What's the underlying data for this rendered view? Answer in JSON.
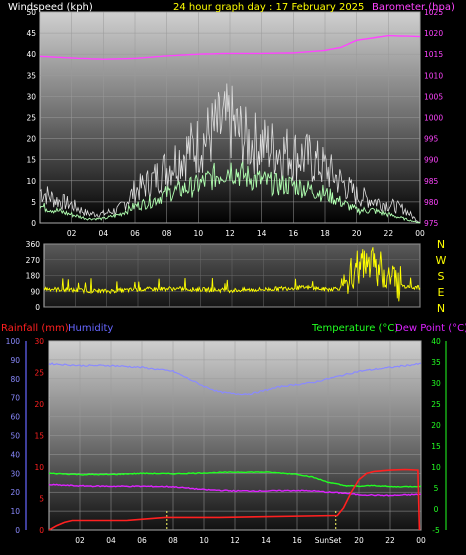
{
  "colors": {
    "white": "#ffffff",
    "yellow": "#ffff00",
    "magenta": "#ff44ff",
    "red": "#ff2020",
    "blue": "#6666ff",
    "green": "#22ff22",
    "purple": "#dd22ff",
    "lightgreen": "#b0ffb0",
    "gust": "#dddddd",
    "humidity": "#8a8aff",
    "sunset": "#ffff66"
  },
  "chart_data": [
    {
      "type": "line",
      "title": "24 hour graph day : 17 February 2025",
      "ylabel_left": "Windspeed (kph)",
      "ylabel_right": "Barometer (hpa)",
      "x_ticks": [
        "02",
        "04",
        "06",
        "08",
        "10",
        "12",
        "14",
        "16",
        "18",
        "20",
        "22",
        "00"
      ],
      "y_left_ticks": [
        "0",
        "5",
        "10",
        "15",
        "20",
        "25",
        "30",
        "35",
        "40",
        "45",
        "50"
      ],
      "y_right_ticks": [
        "975",
        "980",
        "985",
        "990",
        "995",
        "1000",
        "1005",
        "1010",
        "1015",
        "1020",
        "1025"
      ],
      "ylim_left": [
        0,
        50
      ],
      "ylim_right": [
        975,
        1025
      ],
      "series": [
        {
          "name": "Barometer (hpa)",
          "axis": "right",
          "x": [
            0,
            2,
            4,
            6,
            8,
            10,
            12,
            14,
            16,
            18,
            19,
            20,
            22,
            24
          ],
          "y": [
            1014.5,
            1014.1,
            1013.8,
            1014.0,
            1014.6,
            1015.0,
            1015.2,
            1015.2,
            1015.3,
            1015.9,
            1016.6,
            1018.3,
            1019.4,
            1019.2
          ]
        },
        {
          "name": "Gust",
          "axis": "left",
          "x": [
            0,
            1,
            2,
            3,
            4,
            5,
            6,
            7,
            8,
            9,
            10,
            11,
            12,
            13,
            14,
            15,
            16,
            17,
            18,
            19,
            20,
            21,
            22,
            23,
            24
          ],
          "y": [
            7,
            5,
            4,
            2,
            2,
            3,
            7,
            9,
            12,
            15,
            17,
            20,
            22,
            18,
            17,
            16,
            15,
            14,
            12,
            9,
            6,
            5,
            4,
            3,
            0
          ]
        },
        {
          "name": "Average",
          "axis": "left",
          "x": [
            0,
            1,
            2,
            3,
            4,
            5,
            6,
            7,
            8,
            9,
            10,
            11,
            12,
            13,
            14,
            15,
            16,
            17,
            18,
            19,
            20,
            21,
            22,
            23,
            24
          ],
          "y": [
            4,
            3,
            2,
            1,
            1,
            2,
            4,
            5,
            7,
            8,
            9,
            11,
            13,
            11,
            10,
            9,
            9,
            8,
            7,
            5,
            3,
            3,
            2,
            1,
            0
          ]
        }
      ]
    },
    {
      "type": "line",
      "title": "",
      "ylim": [
        0,
        360
      ],
      "y_ticks": [
        "0",
        "90",
        "180",
        "270",
        "360"
      ],
      "compass_labels": [
        "N",
        "W",
        "S",
        "E",
        "N"
      ],
      "series": [
        {
          "name": "Wind direction",
          "x": [
            0,
            2,
            4,
            6,
            8,
            10,
            12,
            14,
            16,
            17,
            18,
            19,
            20,
            21,
            22,
            23,
            24
          ],
          "y": [
            105,
            95,
            90,
            100,
            105,
            100,
            95,
            100,
            110,
            110,
            100,
            110,
            230,
            240,
            180,
            120,
            110
          ]
        }
      ]
    },
    {
      "type": "line",
      "ylabel_left_1": "Rainfall (mm)",
      "ylabel_left_2": "Humidity",
      "ylabel_right_1": "Temperature (°C)",
      "ylabel_right_2": "Dew Point (°C)",
      "x_ticks": [
        "02",
        "04",
        "06",
        "08",
        "10",
        "12",
        "14",
        "16",
        "SunSet",
        "20",
        "22",
        "00"
      ],
      "humidity_ticks": [
        "0",
        "10",
        "20",
        "30",
        "40",
        "50",
        "60",
        "70",
        "80",
        "90",
        "100"
      ],
      "rain_ticks": [
        "0",
        "5",
        "10",
        "15",
        "20",
        "25",
        "30"
      ],
      "temp_ticks": [
        "-5",
        "0",
        "5",
        "10",
        "15",
        "20",
        "25",
        "30",
        "35",
        "40"
      ],
      "ylim_rain": [
        0,
        30
      ],
      "ylim_humidity": [
        0,
        100
      ],
      "ylim_temp": [
        -5,
        40
      ],
      "series": [
        {
          "name": "Humidity",
          "axis": "humidity",
          "x": [
            0,
            2,
            4,
            6,
            8,
            10,
            11,
            12,
            13,
            14,
            15,
            16,
            17,
            18,
            20,
            22,
            24
          ],
          "y": [
            88,
            87,
            87,
            86,
            84,
            76,
            73,
            72,
            72,
            74,
            76,
            77,
            78,
            80,
            84,
            86,
            88
          ]
        },
        {
          "name": "Temperature (°C)",
          "axis": "temp",
          "x": [
            0,
            2,
            4,
            6,
            8,
            10,
            12,
            14,
            16,
            17,
            18,
            19,
            20,
            21,
            22,
            23,
            24
          ],
          "y": [
            8.5,
            8.2,
            8.2,
            8.5,
            8.4,
            8.6,
            8.8,
            8.8,
            8.3,
            7.6,
            6.4,
            5.6,
            5.4,
            5.6,
            5.3,
            5.3,
            5.4
          ]
        },
        {
          "name": "Dew Point (°C)",
          "axis": "temp",
          "x": [
            0,
            2,
            4,
            6,
            8,
            10,
            12,
            14,
            16,
            17,
            18,
            19,
            20,
            22,
            24
          ],
          "y": [
            5.8,
            5.5,
            5.4,
            5.4,
            5.3,
            4.6,
            4.3,
            4.3,
            4.4,
            4.3,
            4.0,
            3.8,
            3.4,
            3.2,
            3.5
          ]
        },
        {
          "name": "Rainfall (mm)",
          "axis": "rain",
          "x": [
            0,
            0.5,
            1,
            1.5,
            2.5,
            5,
            7.5,
            11,
            18.6,
            19,
            19.5,
            20,
            20.5,
            21,
            22,
            23,
            23.8,
            23.9
          ],
          "y": [
            0,
            0.7,
            1.2,
            1.5,
            1.5,
            1.5,
            2,
            2,
            2.3,
            3.5,
            6,
            8,
            9,
            9.3,
            9.5,
            9.6,
            9.5,
            0
          ]
        }
      ],
      "markers": [
        {
          "label": "",
          "x": 7.6
        },
        {
          "label": "SunSet",
          "x": 18.5
        }
      ]
    }
  ]
}
